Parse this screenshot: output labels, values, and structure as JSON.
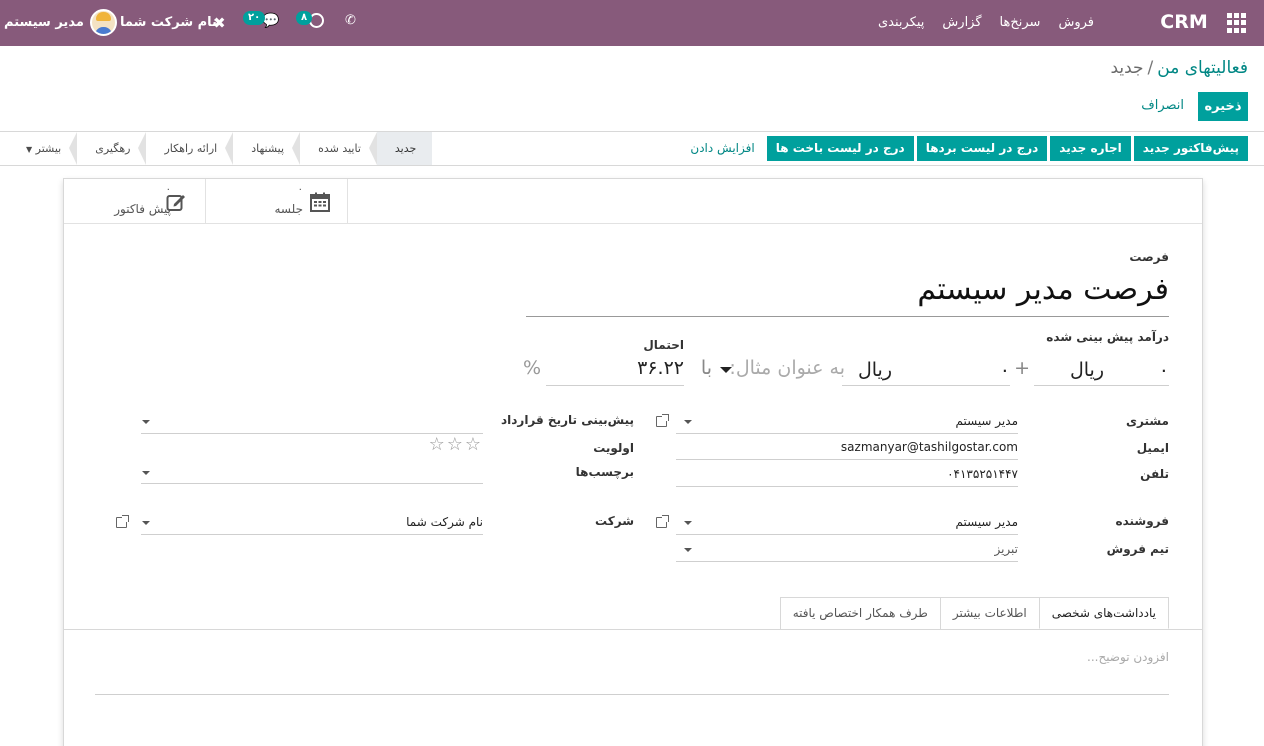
{
  "navbar": {
    "brand": "CRM",
    "menu": [
      "فروش",
      "سرنخ‌ها",
      "گزارش",
      "پیکربندی"
    ],
    "activity_count": "۸",
    "message_count": "۲۰",
    "company": "نام شرکت شما",
    "user": "مدیر سیستم",
    "colors": {
      "bar": "#875a7b",
      "accent": "#00a09d"
    }
  },
  "breadcrumb": {
    "parent": "فعالیتهای من",
    "current": "جدید"
  },
  "control": {
    "save": "ذخیره",
    "discard": "انصراف"
  },
  "actions": [
    {
      "label": "پیش‌فاکتور جدید",
      "style": "primary"
    },
    {
      "label": "اجاره جدید",
      "style": "primary"
    },
    {
      "label": "درج در لیست بردها",
      "style": "primary"
    },
    {
      "label": "درج در لیست باخت ها",
      "style": "primary"
    },
    {
      "label": "افزایش دادن",
      "style": "link"
    }
  ],
  "stages": [
    {
      "label": "جدید",
      "active": true
    },
    {
      "label": "تایید شده",
      "active": false
    },
    {
      "label": "پیشنهاد",
      "active": false
    },
    {
      "label": "ارائه راهکار",
      "active": false
    },
    {
      "label": "رهگیری",
      "active": false
    },
    {
      "label": "بیشتر",
      "active": false
    }
  ],
  "smart_buttons": [
    {
      "count": "۰",
      "label": "جلسه",
      "icon": "calendar-icon"
    },
    {
      "count": "۰",
      "label": "پیش فاکتور",
      "icon": "edit-icon"
    }
  ],
  "form": {
    "opportunity_label": "فرصت",
    "opportunity_name": "فرصت مدیر سیستم",
    "expected_revenue_label": "درآمد پیش بینی شده",
    "revenue_value": "۰",
    "revenue_currency": "ریال",
    "plus": "+",
    "recurring_value": "۰",
    "recurring_currency": "ریال",
    "recurring_placeholder": "به عنوان مثال:",
    "with": "با",
    "probability_label": "احتمال",
    "probability": "۳۶.۲۲",
    "percent": "%",
    "customer_label": "مشتری",
    "customer": "مدیر سیستم",
    "email_label": "ایمیل",
    "email": "sazmanyar@tashilgostar.com",
    "phone_label": "تلفن",
    "phone": "۰۴۱۳۵۲۵۱۴۴۷",
    "deadline_label": "پیش‌بینی تاریخ قرارداد",
    "priority_label": "اولویت",
    "priority_stars": 0,
    "tags_label": "برچسب‌ها",
    "salesperson_label": "فروشنده",
    "salesperson": "مدیر سیستم",
    "sales_team_label": "تیم فروش",
    "sales_team": "تبریز",
    "company_label": "شرکت",
    "company": "نام شرکت شما"
  },
  "tabs": [
    {
      "label": "یادداشت‌های شخصی",
      "active": true
    },
    {
      "label": "اطلاعات بیشتر",
      "active": false
    },
    {
      "label": "طرف همکار اختصاص یافته",
      "active": false
    }
  ],
  "notes_placeholder": "افزودن توضیح..."
}
